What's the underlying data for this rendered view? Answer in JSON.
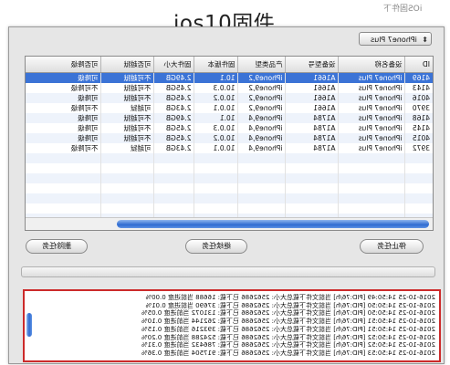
{
  "page": {
    "title": "ios10固件",
    "watermark": "iOS固件下"
  },
  "device_select": {
    "value": "iPhone7 Plus"
  },
  "table": {
    "columns": [
      "ID",
      "设备名称",
      "设备型号",
      "产品类型",
      "固件版本",
      "固件大小",
      "可否越狱",
      "可否降级"
    ],
    "rows": [
      [
        "4169",
        "iPhone7 Plus",
        "A1661",
        "iPhone9,2",
        "10.1",
        "2.49GB",
        "不可越狱",
        "可降级",
        "sel"
      ],
      [
        "4143",
        "iPhone7 Plus",
        "A1661",
        "iPhone9,2",
        "10.0.3",
        "2.45GB",
        "不可越狱",
        "不可降级",
        ""
      ],
      [
        "4016",
        "iPhone7 Plus",
        "A1661",
        "iPhone9,2",
        "10.0.2",
        "2.45GB",
        "不可越狱",
        "可降级",
        "alt"
      ],
      [
        "3970",
        "iPhone7 Plus",
        "A1661",
        "iPhone9,2",
        "10.0.1",
        "2.43GB",
        "可越狱",
        "不可降级",
        ""
      ],
      [
        "4168",
        "iPhone7 Plus",
        "A1784",
        "iPhone9,4",
        "10.1",
        "2.49GB",
        "不可越狱",
        "可降级",
        "alt"
      ],
      [
        "4145",
        "iPhone7 Plus",
        "A1784",
        "iPhone9,4",
        "10.0.3",
        "2.45GB",
        "不可越狱",
        "可降级",
        ""
      ],
      [
        "4015",
        "iPhone7 Plus",
        "A1784",
        "iPhone9,4",
        "10.0.2",
        "2.45GB",
        "不可越狱",
        "可降级",
        "alt"
      ],
      [
        "3972",
        "iPhone7 Plus",
        "A1784",
        "iPhone9,4",
        "10.0.1",
        "2.43GB",
        "可越狱",
        "不可降级",
        ""
      ]
    ],
    "empty_rows": 8
  },
  "buttons": {
    "stop": "停止任务",
    "resume": "继续任务",
    "delete": "删除任务"
  },
  "log": {
    "lines": [
      "2016-10-25 14:50:49 [PID:76/h] 当前文件下载总大小: 2562686 已下载: 16688 当前进度 0.00%",
      "2016-10-25 14:50:50 [PID:76/h] 当前文件下载总大小: 2562686 已下载: 37690 当前进度 0.01%",
      "2016-10-25 14:50:50 [PID:76/h] 当前文件下载总大小: 2562686 已下载: 131072 当前进度 0.05%",
      "2016-10-25 14:50:51 [PID:76/h] 当前文件下载总大小: 2562686 已下载: 262144 当前进度 0.10%",
      "2016-10-25 14:50:51 [PID:76/h] 当前文件下载总大小: 2562686 已下载: 393216 当前进度 0.15%",
      "2016-10-25 14:50:52 [PID:76/h] 当前文件下载总大小: 2562686 已下载: 524288 当前进度 0.20%",
      "2016-10-25 14:50:52 [PID:76/h] 当前文件下载总大小: 2562686 已下载: 786432 当前进度 0.31%",
      "2016-10-25 14:50:53 [PID:76/h] 当前文件下载总大小: 2562686 已下载: 917504 当前进度 0.36%"
    ]
  },
  "colors": {
    "selection": "#3b73d6",
    "log_border": "#cc2a2a",
    "scroll_thumb": "#2f6bd1"
  }
}
